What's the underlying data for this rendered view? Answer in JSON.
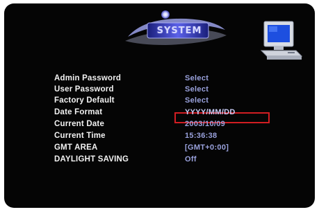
{
  "header": {
    "title": "SYSTEM"
  },
  "menu": {
    "items": [
      {
        "label": "Admin Password",
        "value": "Select"
      },
      {
        "label": "User Password",
        "value": "Select"
      },
      {
        "label": "Factory Default",
        "value": "Select"
      },
      {
        "label": "Date Format",
        "value": "YYYY/MM/DD"
      },
      {
        "label": "Current Date",
        "value": "2003/10/09"
      },
      {
        "label": "Current Time",
        "value": "15:36:38"
      },
      {
        "label": "GMT AREA",
        "value": "[GMT+0:00]"
      },
      {
        "label": "DAYLIGHT SAVING",
        "value": "Off"
      }
    ],
    "selected_index": 3
  },
  "icons": {
    "logo": "system-logo-icon",
    "computer": "computer-icon"
  },
  "colors": {
    "background": "#050505",
    "label": "#f2f2f2",
    "value": "#9aa2dd",
    "highlight_border": "#d21d22",
    "logo_accent": "#4c50c8"
  }
}
